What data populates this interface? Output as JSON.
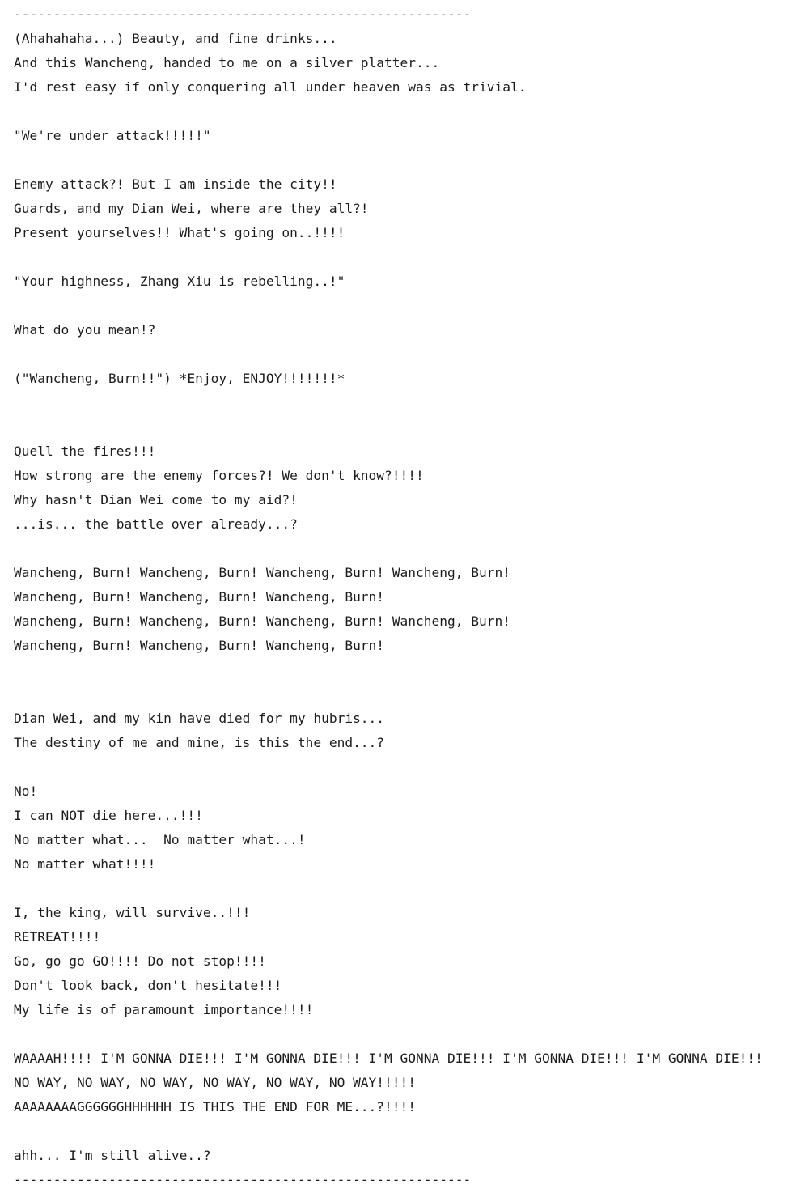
{
  "lyrics": {
    "lines": [
      "----------------------------------------------------------",
      "(Ahahahaha...) Beauty, and fine drinks...",
      "And this Wancheng, handed to me on a silver platter...",
      "I'd rest easy if only conquering all under heaven was as trivial.",
      "",
      "\"We're under attack!!!!!\"",
      "",
      "Enemy attack?! But I am inside the city!!",
      "Guards, and my Dian Wei, where are they all?!",
      "Present yourselves!! What's going on..!!!!",
      "",
      "\"Your highness, Zhang Xiu is rebelling..!\"",
      "",
      "What do you mean!?",
      "",
      "(\"Wancheng, Burn!!\") *Enjoy, ENJOY!!!!!!!*",
      "",
      "",
      "Quell the fires!!!",
      "How strong are the enemy forces?! We don't know?!!!!",
      "Why hasn't Dian Wei come to my aid?!",
      "...is... the battle over already...?",
      "",
      "Wancheng, Burn! Wancheng, Burn! Wancheng, Burn! Wancheng, Burn!",
      "Wancheng, Burn! Wancheng, Burn! Wancheng, Burn!",
      "Wancheng, Burn! Wancheng, Burn! Wancheng, Burn! Wancheng, Burn!",
      "Wancheng, Burn! Wancheng, Burn! Wancheng, Burn!",
      "",
      "",
      "Dian Wei, and my kin have died for my hubris...",
      "The destiny of me and mine, is this the end...?",
      "",
      "No!",
      "I can NOT die here...!!!",
      "No matter what...  No matter what...!",
      "No matter what!!!!",
      "",
      "I, the king, will survive..!!!",
      "RETREAT!!!!",
      "Go, go go GO!!!! Do not stop!!!!",
      "Don't look back, don't hesitate!!!",
      "My life is of paramount importance!!!!",
      "",
      "WAAAAH!!!! I'M GONNA DIE!!! I'M GONNA DIE!!! I'M GONNA DIE!!! I'M GONNA DIE!!! I'M GONNA DIE!!!",
      "NO WAY, NO WAY, NO WAY, NO WAY, NO WAY, NO WAY!!!!!",
      "AAAAAAAAGGGGGGHHHHHH IS THIS THE END FOR ME...?!!!!",
      "",
      "ahh... I'm still alive..?",
      "----------------------------------------------------------"
    ]
  }
}
